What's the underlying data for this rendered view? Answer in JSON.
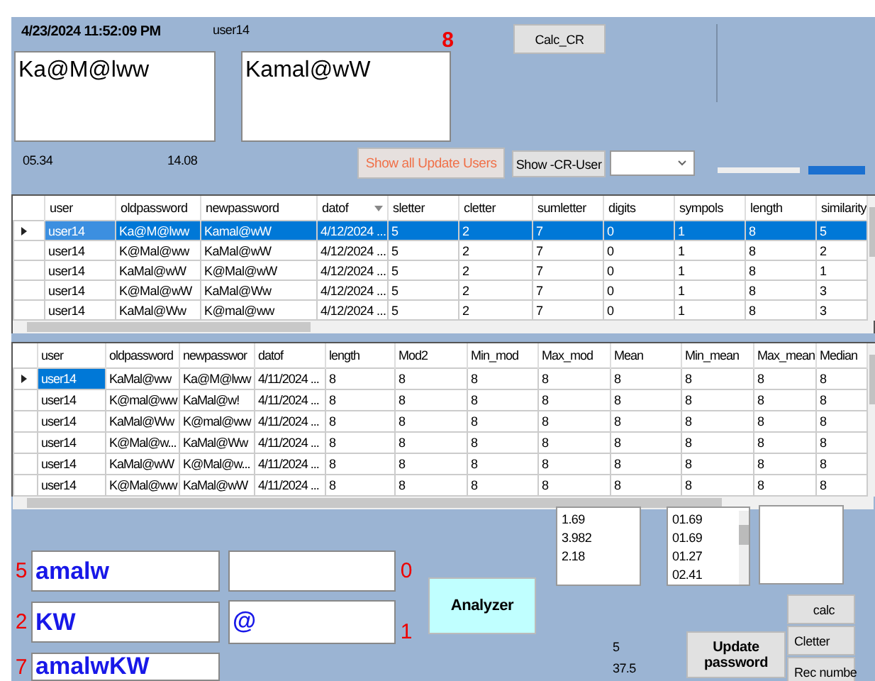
{
  "header": {
    "timestamp": "4/23/2024 11:52:09 PM",
    "user": "user14",
    "old_password": "Ka@M@lww",
    "new_password": "Kamal@wW",
    "count": "8",
    "value_1": "05.34",
    "value_2": "14.08"
  },
  "buttons": {
    "calc_cr": "Calc_CR",
    "show_all": "Show all Update Users",
    "show_cr_user": "Show -CR-User",
    "analyzer": "Analyzer",
    "update_password": "Update password",
    "side": [
      "calc",
      "Cletter",
      "Rec numbe"
    ]
  },
  "table_1": {
    "columns": [
      {
        "label": "user",
        "sorted": false
      },
      {
        "label": "oldpassword",
        "sorted": false
      },
      {
        "label": "newpassword",
        "sorted": false
      },
      {
        "label": "datof",
        "sorted": true
      },
      {
        "label": "sletter",
        "sorted": false
      },
      {
        "label": "cletter",
        "sorted": false
      },
      {
        "label": "sumletter",
        "sorted": false
      },
      {
        "label": "digits",
        "sorted": false
      },
      {
        "label": "sympols",
        "sorted": false
      },
      {
        "label": "length",
        "sorted": false
      },
      {
        "label": "similarity",
        "sorted": false
      }
    ],
    "rows": [
      {
        "selected": true,
        "cells": [
          "user14",
          "Ka@M@lww",
          "Kamal@wW",
          "4/12/2024 ...",
          "5",
          "2",
          "7",
          "0",
          "1",
          "8",
          "5"
        ]
      },
      {
        "selected": false,
        "cells": [
          "user14",
          "K@Mal@ww",
          "KaMal@wW",
          "4/12/2024 ...",
          "5",
          "2",
          "7",
          "0",
          "1",
          "8",
          "2"
        ]
      },
      {
        "selected": false,
        "cells": [
          "user14",
          "KaMal@wW",
          "K@Mal@wW",
          "4/12/2024 ...",
          "5",
          "2",
          "7",
          "0",
          "1",
          "8",
          "1"
        ]
      },
      {
        "selected": false,
        "cells": [
          "user14",
          "K@Mal@wW",
          "KaMal@Ww",
          "4/12/2024 ...",
          "5",
          "2",
          "7",
          "0",
          "1",
          "8",
          "3"
        ]
      },
      {
        "selected": false,
        "cells": [
          "user14",
          "KaMal@Ww",
          "K@mal@ww",
          "4/12/2024 ...",
          "5",
          "2",
          "7",
          "0",
          "1",
          "8",
          "3"
        ]
      }
    ]
  },
  "table_2": {
    "columns": [
      {
        "label": "user",
        "sorted": false
      },
      {
        "label": "oldpassword",
        "sorted": false
      },
      {
        "label": "newpasswor",
        "sorted": false
      },
      {
        "label": "datof",
        "sorted": false
      },
      {
        "label": "length",
        "sorted": false
      },
      {
        "label": "Mod2",
        "sorted": false
      },
      {
        "label": "Min_mod",
        "sorted": false
      },
      {
        "label": "Max_mod",
        "sorted": false
      },
      {
        "label": "Mean",
        "sorted": false
      },
      {
        "label": "Min_mean",
        "sorted": false
      },
      {
        "label": "Max_mean",
        "sorted": false
      },
      {
        "label": "Median",
        "sorted": false
      }
    ],
    "rows": [
      {
        "selected": true,
        "cells": [
          "user14",
          "KaMal@ww",
          "Ka@M@lww",
          "4/11/2024 ...",
          "8",
          "8",
          "8",
          "8",
          "8",
          "8",
          "8",
          "8"
        ]
      },
      {
        "selected": false,
        "cells": [
          "user14",
          "K@mal@ww",
          "KaMal@w!",
          "4/11/2024 ...",
          "8",
          "8",
          "8",
          "8",
          "8",
          "8",
          "8",
          "8"
        ]
      },
      {
        "selected": false,
        "cells": [
          "user14",
          "KaMal@Ww",
          "K@mal@ww",
          "4/11/2024 ...",
          "8",
          "8",
          "8",
          "8",
          "8",
          "8",
          "8",
          "8"
        ]
      },
      {
        "selected": false,
        "cells": [
          "user14",
          "K@Mal@w...",
          "KaMal@Ww",
          "4/11/2024 ...",
          "8",
          "8",
          "8",
          "8",
          "8",
          "8",
          "8",
          "8"
        ]
      },
      {
        "selected": false,
        "cells": [
          "user14",
          "KaMal@wW",
          "K@Mal@w...",
          "4/11/2024 ...",
          "8",
          "8",
          "8",
          "8",
          "8",
          "8",
          "8",
          "8"
        ]
      },
      {
        "selected": false,
        "cells": [
          "user14",
          "K@Mal@ww",
          "KaMal@wW",
          "4/11/2024 ...",
          "8",
          "8",
          "8",
          "8",
          "8",
          "8",
          "8",
          "8"
        ]
      }
    ]
  },
  "fields": [
    {
      "count": "5",
      "value": "amalw"
    },
    {
      "count": "0"
    },
    {
      "count": "2",
      "value": "KW"
    },
    {
      "count": "1",
      "value": "@"
    },
    {
      "count": "7",
      "value": "amalwKW"
    }
  ],
  "list_1": [
    "1.69",
    "3.982",
    "2.18"
  ],
  "list_2": [
    "01.69",
    "01.69",
    "01.27",
    "02.41"
  ],
  "results": [
    "5",
    "37.5"
  ]
}
